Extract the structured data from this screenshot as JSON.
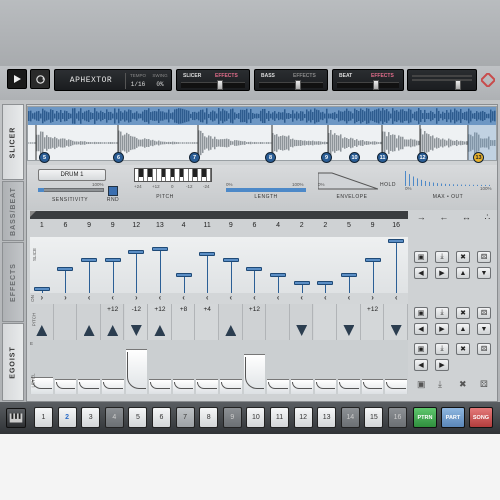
{
  "transport": {
    "song_name": "APHEXTOR",
    "tempo_label": "TEMPO",
    "tempo_value": "1/16",
    "swing_label": "SWING",
    "swing_value": "0%"
  },
  "instruments": [
    {
      "name": "SLICER",
      "effects": "EFFECTS"
    },
    {
      "name": "BASS",
      "effects": "EFFECTS"
    },
    {
      "name": "BEAT",
      "effects": "EFFECTS"
    }
  ],
  "side_tabs": [
    "SLICER",
    "BASS/BEAT",
    "EFFECTS",
    "EGOIST"
  ],
  "slicer": {
    "markers": [
      "5",
      "6",
      "7",
      "8",
      "9",
      "10",
      "11",
      "12",
      "13"
    ],
    "drum_select": "DRUM 1",
    "sensitivity_label": "SENSITIVITY",
    "sensitivity_max": "100%",
    "rnd_label": "RND",
    "pitch_label": "PITCH",
    "pitch_ticks": [
      "+24",
      "+12",
      "0",
      "-12",
      "-24"
    ],
    "length_label": "LENGTH",
    "length_ticks": [
      "0%",
      "100%"
    ],
    "envelope_label": "ENVELOPE",
    "hold_label": "HOLD",
    "hold_ticks": [
      "0%"
    ],
    "maxout_label": "MAX • OUT",
    "maxout_ticks": [
      "0%",
      "100%"
    ]
  },
  "sequencer": {
    "row_labels": [
      "SLICE",
      "ON",
      "PITCH",
      "E",
      "LEVEL"
    ],
    "slice_numbers": [
      "1",
      "6",
      "9",
      "9",
      "12",
      "13",
      "4",
      "11",
      "9",
      "6",
      "4",
      "2",
      "2",
      "5",
      "9",
      "16"
    ],
    "slice_heights": [
      0,
      0.42,
      0.6,
      0.6,
      0.78,
      0.84,
      0.3,
      0.72,
      0.6,
      0.42,
      0.3,
      0.12,
      0.12,
      0.3,
      0.6,
      1.0
    ],
    "pan_marks": [
      "›",
      "›",
      "‹",
      "‹",
      "›",
      "‹",
      "‹",
      "‹",
      "‹",
      "‹",
      "‹",
      "‹",
      "‹",
      "‹",
      "›",
      "‹"
    ],
    "pitch_values": [
      "",
      "",
      "",
      "+12",
      "-12",
      "+12",
      "+8",
      "+4",
      "",
      "+12",
      "",
      "",
      "",
      "",
      "+12",
      ""
    ],
    "envelopes": [
      "up",
      "",
      "up",
      "up",
      "dn",
      "up",
      "",
      "",
      "up",
      "",
      "",
      "dn",
      "",
      "dn",
      "",
      "dn"
    ],
    "levels": [
      0.35,
      0.3,
      0.3,
      0.3,
      0.9,
      0.3,
      0.3,
      0.3,
      0.3,
      0.8,
      0.3,
      0.3,
      0.3,
      0.3,
      0.3,
      0.3
    ]
  },
  "right_panel": {
    "arrows": [
      "→",
      "←",
      "↔",
      "∴"
    ]
  },
  "patterns": [
    "1",
    "2",
    "3",
    "4",
    "5",
    "6",
    "7",
    "8",
    "9",
    "10",
    "11",
    "12",
    "13",
    "14",
    "15",
    "16"
  ],
  "pattern_current": "2",
  "modes": [
    "PTRN",
    "PART",
    "SONG"
  ],
  "colors": {
    "accent_blue": "#2b6cc8",
    "effects_pink": "#e06c8a",
    "ptrn_green": "#3fa650",
    "song_red": "#c83a3a"
  }
}
